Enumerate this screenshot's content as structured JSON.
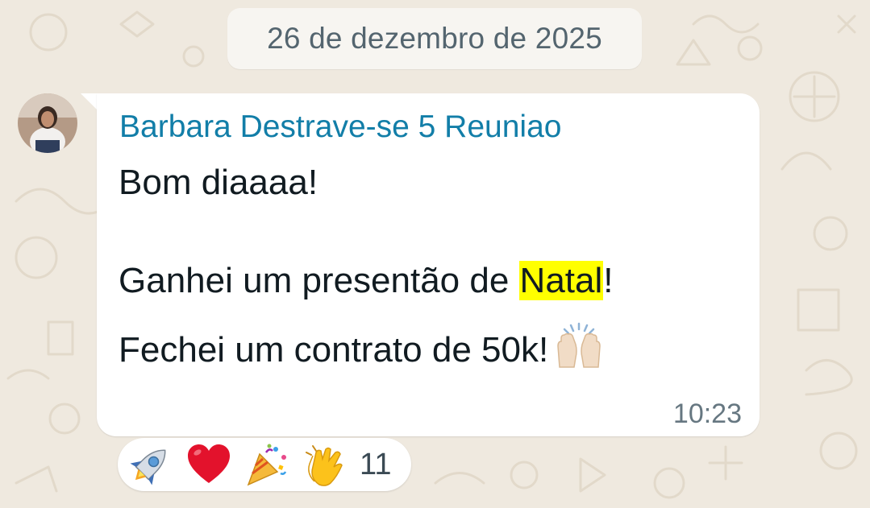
{
  "chat": {
    "date_separator": "26 de dezembro de 2025"
  },
  "message": {
    "sender": "Barbara Destrave-se 5 Reuniao",
    "line1": "Bom diaaaa!",
    "line2_before": "Ganhei um presentão de ",
    "line2_highlight": "Natal",
    "line2_after": "!",
    "line3": "Fechei um contrato de 50k!",
    "line3_emoji": "raising-hands-emoji",
    "time": "10:23"
  },
  "reactions": {
    "emojis": [
      "rocket-emoji",
      "red-heart-emoji",
      "party-popper-emoji",
      "clapping-hands-emoji"
    ],
    "count": "11"
  },
  "colors": {
    "sender_name": "#127ea8",
    "highlight": "#ffff00",
    "wallpaper": "#efe9df",
    "bubble": "#ffffff"
  }
}
